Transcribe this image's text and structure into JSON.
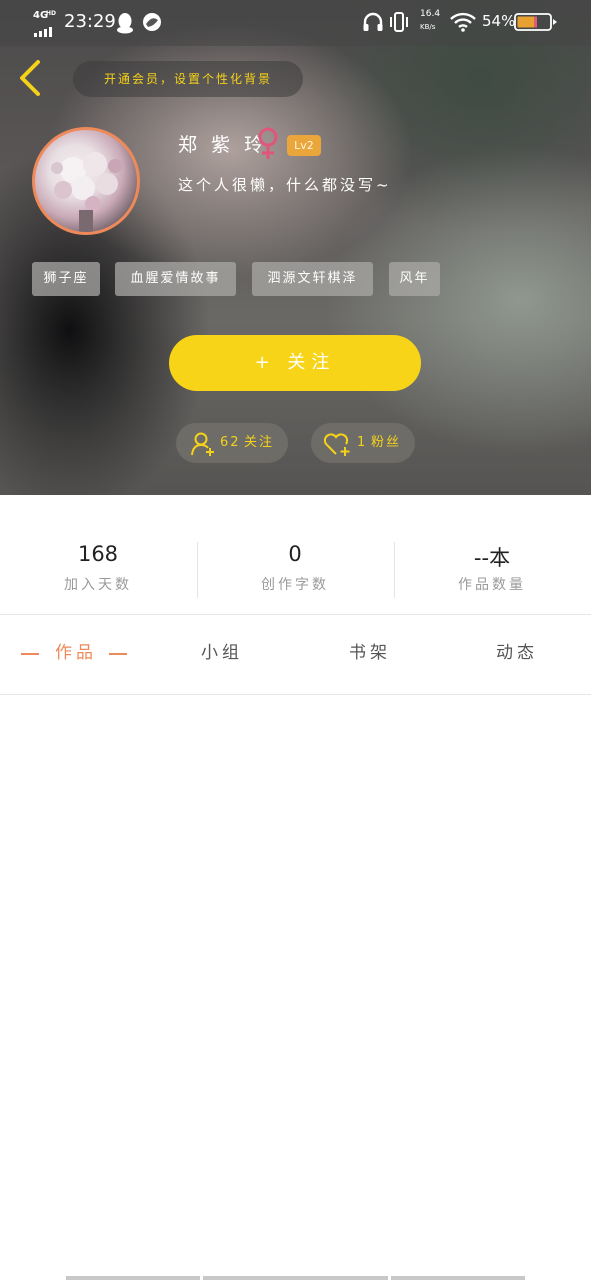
{
  "status_bar": {
    "network": "4G",
    "network_sup": "HD",
    "time": "23:29",
    "speed_value": "16.4",
    "speed_unit": "KB/s",
    "battery": "54%"
  },
  "header": {
    "vip_prompt": "开通会员，设置个性化背景"
  },
  "profile": {
    "username": "郑 紫 玲",
    "level_badge": "Lv2",
    "bio": "这个人很懒，什么都没写~",
    "tags": [
      "狮子座",
      "血腥爱情故事",
      "泗源文轩棋泽",
      "风年"
    ]
  },
  "actions": {
    "follow_label": "+  关注",
    "following_count": "62",
    "following_label": "关注",
    "fans_count": "1",
    "fans_label": "粉丝"
  },
  "stats": [
    {
      "value": "168",
      "label": "加入天数"
    },
    {
      "value": "0",
      "label": "创作字数"
    },
    {
      "value": "--本",
      "label": "作品数量"
    }
  ],
  "tabs": [
    {
      "label": "作品",
      "active": true
    },
    {
      "label": "小组",
      "active": false
    },
    {
      "label": "书架",
      "active": false
    },
    {
      "label": "动态",
      "active": false
    }
  ],
  "colors": {
    "accent_yellow": "#f8d418",
    "accent_orange": "#ee8a5a",
    "female_pink": "#e0567a",
    "level_badge": "#eaa53b"
  }
}
